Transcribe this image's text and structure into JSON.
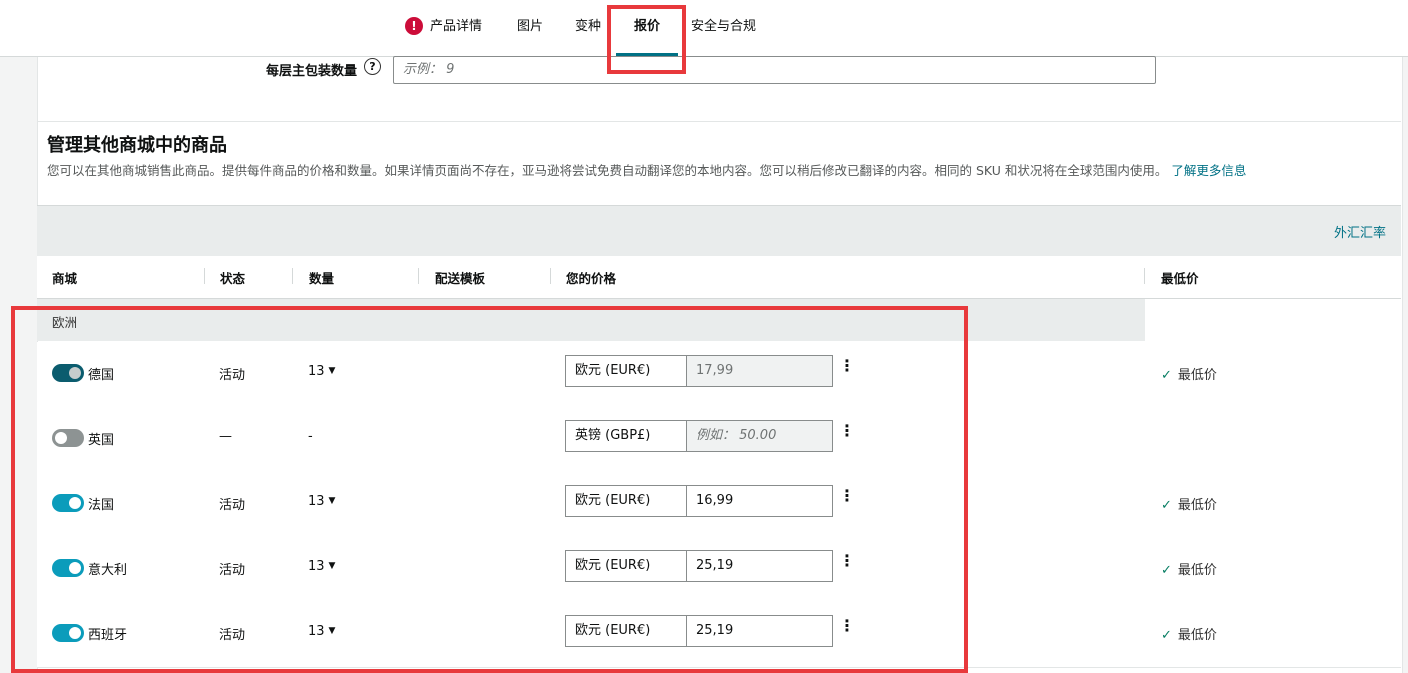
{
  "tabs": [
    {
      "label": "产品详情",
      "alert": "!"
    },
    {
      "label": "图片"
    },
    {
      "label": "变种"
    },
    {
      "label": "报价"
    },
    {
      "label": "安全与合规"
    }
  ],
  "active_tab": "报价",
  "package_field": {
    "label": "每层主包装数量",
    "help": "?",
    "placeholder": "示例： 9"
  },
  "section": {
    "title": "管理其他商城中的商品",
    "description": "您可以在其他商城销售此商品。提供每件商品的价格和数量。如果详情页面尚不存在，亚马逊将尝试免费自动翻译您的本地内容。您可以稍后修改已翻译的内容。相同的 SKU 和状况将在全球范围内使用。",
    "learn_more": "了解更多信息"
  },
  "fx_link": "外汇汇率",
  "columns": {
    "marketplace": "商城",
    "status": "状态",
    "quantity": "数量",
    "shipping": "配送模板",
    "price": "您的价格",
    "lowest": "最低价"
  },
  "region": "欧洲",
  "rows": [
    {
      "market": "德国",
      "toggle": "on-disabled",
      "status": "活动",
      "qty": "13",
      "qty_dropdown": true,
      "currency": "欧元 (EUR€)",
      "price": "17,99",
      "price_state": "disabled",
      "lowest": "最低价"
    },
    {
      "market": "英国",
      "toggle": "off",
      "status": "—",
      "qty": "-",
      "qty_dropdown": false,
      "currency": "英镑 (GBP£)",
      "price": "例如： 50.00",
      "price_state": "placeholder",
      "lowest": ""
    },
    {
      "market": "法国",
      "toggle": "on",
      "status": "活动",
      "qty": "13",
      "qty_dropdown": true,
      "currency": "欧元 (EUR€)",
      "price": "16,99",
      "price_state": "normal",
      "lowest": "最低价"
    },
    {
      "market": "意大利",
      "toggle": "on",
      "status": "活动",
      "qty": "13",
      "qty_dropdown": true,
      "currency": "欧元 (EUR€)",
      "price": "25,19",
      "price_state": "normal",
      "lowest": "最低价"
    },
    {
      "market": "西班牙",
      "toggle": "on",
      "status": "活动",
      "qty": "13",
      "qty_dropdown": true,
      "currency": "欧元 (EUR€)",
      "price": "25,19",
      "price_state": "normal",
      "lowest": "最低价"
    }
  ],
  "colors": {
    "accent": "#007185",
    "toggle_on": "#0b9cbb",
    "toggle_on_disabled": "#0b5c6e",
    "toggle_off": "#8d9393",
    "highlight": "#e8393c",
    "check": "#067d62"
  }
}
